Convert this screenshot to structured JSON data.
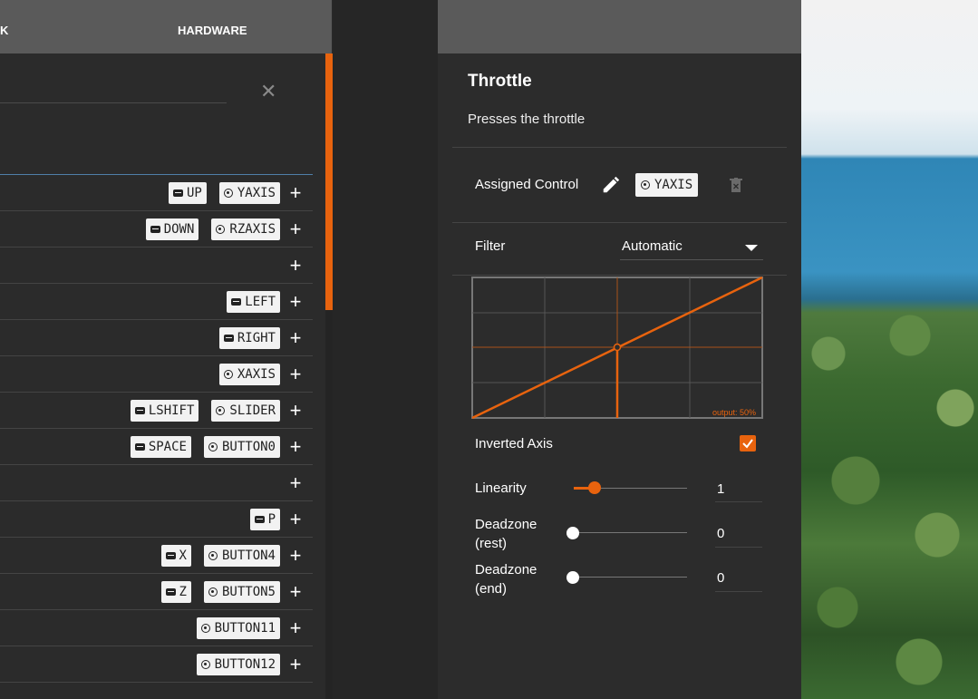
{
  "tabs": {
    "left_partial": "K",
    "hardware": "HARDWARE"
  },
  "search": {
    "close_icon": "close-icon"
  },
  "bindings": [
    {
      "chips": [
        {
          "kind": "keyboard",
          "label": "UP"
        },
        {
          "kind": "joystick",
          "label": "YAXIS"
        }
      ]
    },
    {
      "chips": [
        {
          "kind": "keyboard",
          "label": "DOWN"
        },
        {
          "kind": "joystick",
          "label": "RZAXIS"
        }
      ]
    },
    {
      "chips": []
    },
    {
      "chips": [
        {
          "kind": "keyboard",
          "label": "LEFT"
        }
      ]
    },
    {
      "chips": [
        {
          "kind": "keyboard",
          "label": "RIGHT"
        }
      ]
    },
    {
      "chips": [
        {
          "kind": "joystick",
          "label": "XAXIS"
        }
      ]
    },
    {
      "chips": [
        {
          "kind": "keyboard",
          "label": "LSHIFT"
        },
        {
          "kind": "joystick",
          "label": "SLIDER"
        }
      ]
    },
    {
      "chips": [
        {
          "kind": "keyboard",
          "label": "SPACE"
        },
        {
          "kind": "joystick",
          "label": "BUTTON0"
        }
      ]
    },
    {
      "chips": []
    },
    {
      "chips": [
        {
          "kind": "keyboard",
          "label": "P"
        }
      ]
    },
    {
      "chips": [
        {
          "kind": "keyboard",
          "label": "X"
        },
        {
          "kind": "joystick",
          "label": "BUTTON4"
        }
      ]
    },
    {
      "chips": [
        {
          "kind": "keyboard",
          "label": "Z"
        },
        {
          "kind": "joystick",
          "label": "BUTTON5"
        }
      ]
    },
    {
      "chips": [
        {
          "kind": "joystick",
          "label": "BUTTON11"
        }
      ]
    },
    {
      "chips": [
        {
          "kind": "joystick",
          "label": "BUTTON12"
        }
      ]
    }
  ],
  "detail": {
    "title": "Throttle",
    "description": "Presses the throttle",
    "assigned_label": "Assigned Control",
    "assigned_value": "YAXIS",
    "filter_label": "Filter",
    "filter_value": "Automatic",
    "graph_output": "output: 50%",
    "inverted_label": "Inverted Axis",
    "inverted_checked": true,
    "linearity_label": "Linearity",
    "linearity_value": "1",
    "deadzone_rest_label": "Deadzone (rest)",
    "deadzone_rest_value": "0",
    "deadzone_end_label": "Deadzone (end)",
    "deadzone_end_value": "0"
  },
  "colors": {
    "accent": "#e8630e",
    "panel": "#2c2c2c",
    "header": "#5a5a5a"
  }
}
